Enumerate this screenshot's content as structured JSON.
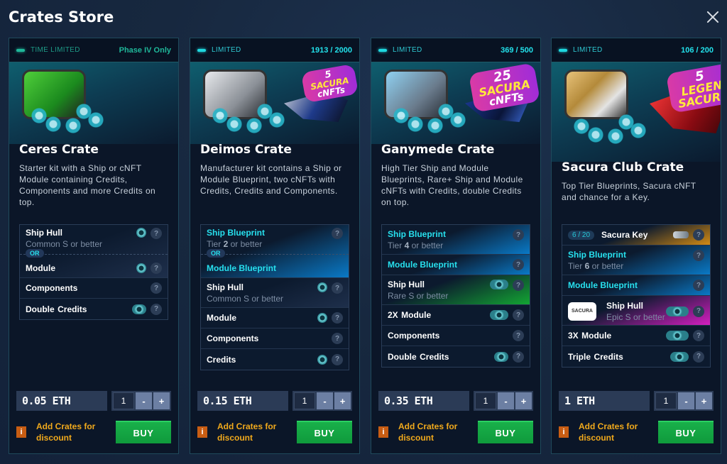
{
  "window": {
    "title": "Crates Store",
    "close_icon": "close-icon"
  },
  "crates": [
    {
      "status_label": "TIME LIMITED",
      "status_value": "Phase IV Only",
      "name": "Ceres Crate",
      "description": "Starter kit with a Ship or cNFT Module containing Credits, Components and more Credits on top.",
      "items": [
        {
          "name": "Ship Hull",
          "sub": "Common S or better",
          "or": "OR",
          "alt_name": "Module"
        },
        {
          "name": "Components"
        },
        {
          "highlight": "Double",
          "name": "Credits"
        }
      ],
      "price": "0.05 ETH",
      "quantity": "1",
      "discount_text": "Add Crates for discount",
      "buy_label": "BUY"
    },
    {
      "status_label": "LIMITED",
      "status_value": "1913 / 2000",
      "badge": {
        "count": "5",
        "line1": "SACURA",
        "line2": "cNFTs"
      },
      "name": "Deimos Crate",
      "description": "Manufacturer kit contains a Ship or Module Blueprint, two cNFTs with Credits, Credits and Components.",
      "items": [
        {
          "name": "Ship Blueprint",
          "sub_prefix": "Tier",
          "sub_bold": "2",
          "sub_suffix": "or better",
          "or": "OR",
          "alt_name": "Module Blueprint"
        },
        {
          "name": "Ship Hull",
          "sub": "Common S or better"
        },
        {
          "name": "Module"
        },
        {
          "name": "Components"
        },
        {
          "name": "Credits"
        }
      ],
      "price": "0.15 ETH",
      "quantity": "1",
      "discount_text": "Add Crates for discount",
      "buy_label": "BUY"
    },
    {
      "status_label": "LIMITED",
      "status_value": "369 / 500",
      "badge": {
        "count": "25",
        "line1": "SACURA",
        "line2": "cNFTs"
      },
      "name": "Ganymede Crate",
      "description": "High Tier Ship and Module Blueprints, Rare+ Ship and Module cNFTs with Credits, double Credits on top.",
      "items": [
        {
          "name": "Ship Blueprint",
          "sub_prefix": "Tier",
          "sub_bold": "4",
          "sub_suffix": "or better"
        },
        {
          "name": "Module Blueprint"
        },
        {
          "name": "Ship Hull",
          "sub": "Rare S or better"
        },
        {
          "highlight": "2X",
          "name": "Module"
        },
        {
          "name": "Components"
        },
        {
          "highlight": "Double",
          "name": "Credits"
        }
      ],
      "price": "0.35 ETH",
      "quantity": "1",
      "discount_text": "Add Crates for discount",
      "buy_label": "BUY"
    },
    {
      "status_label": "LIMITED",
      "status_value": "106 / 200",
      "badge": {
        "count": "5",
        "line1": "LEGEN",
        "line2": "SACURA"
      },
      "name": "Sacura Club Crate",
      "description": "Top Tier Blueprints, Sacura cNFT and chance for a Key.",
      "items": [
        {
          "count": "6 / 20",
          "name": "Sacura Key"
        },
        {
          "name": "Ship Blueprint",
          "sub_prefix": "Tier",
          "sub_bold": "6",
          "sub_suffix": "or better"
        },
        {
          "name": "Module Blueprint"
        },
        {
          "logo": "SACURA",
          "name": "Ship Hull",
          "sub": "Epic S or better"
        },
        {
          "highlight": "3X",
          "name": "Module"
        },
        {
          "highlight": "Triple",
          "name": "Credits"
        }
      ],
      "price": "1 ETH",
      "quantity": "1",
      "discount_text": "Add Crates for discount",
      "buy_label": "BUY"
    }
  ],
  "stepper": {
    "minus": "-",
    "plus": "+"
  },
  "help_glyph": "?",
  "info_glyph": "i",
  "colors": {
    "accent_cyan": "#27e0ee",
    "highlight_yellow": "#ffe31a",
    "buy_green": "#19b04a",
    "discount_orange": "#f0a91c"
  }
}
